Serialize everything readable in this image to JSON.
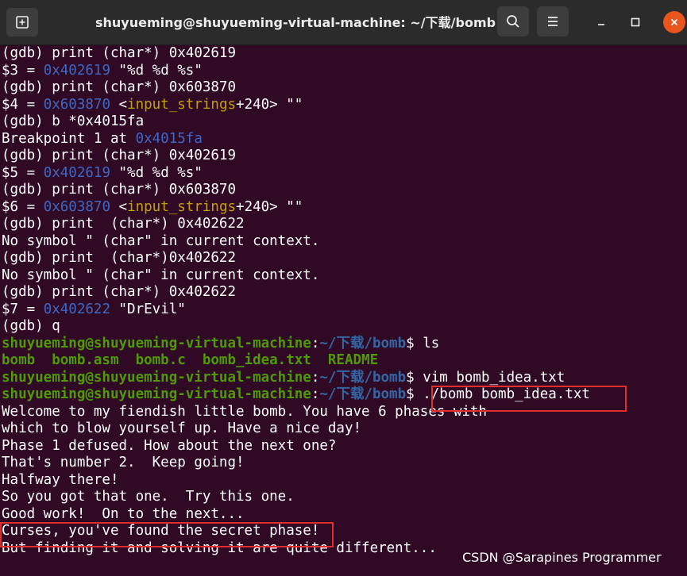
{
  "window": {
    "title": "shuyueming@shuyueming-virtual-machine: ~/下载/bomb"
  },
  "icons": {
    "new_tab": "new-tab-icon",
    "search": "search-icon",
    "menu": "hamburger-menu-icon",
    "minimize": "minimize-icon",
    "maximize": "maximize-icon",
    "close": "close-icon"
  },
  "colors": {
    "background": "#300a24",
    "address": "#3d67c6",
    "symbol": "#c4a000",
    "prompt_user": "#4e9a06",
    "prompt_path": "#3465a4",
    "highlight_box": "#e32d2d"
  },
  "lines": [
    {
      "segments": [
        {
          "t": "(gdb) print (char*) 0x402619"
        }
      ]
    },
    {
      "segments": [
        {
          "t": "$3 = "
        },
        {
          "t": "0x402619",
          "c": "blue"
        },
        {
          "t": " \"%d %d %s\""
        }
      ]
    },
    {
      "segments": [
        {
          "t": "(gdb) print (char*) 0x603870"
        }
      ]
    },
    {
      "segments": [
        {
          "t": "$4 = "
        },
        {
          "t": "0x603870",
          "c": "blue"
        },
        {
          "t": " <"
        },
        {
          "t": "input_strings",
          "c": "yellow"
        },
        {
          "t": "+240> \"\""
        }
      ]
    },
    {
      "segments": [
        {
          "t": "(gdb) b *0x4015fa"
        }
      ]
    },
    {
      "segments": [
        {
          "t": "Breakpoint 1 at "
        },
        {
          "t": "0x4015fa",
          "c": "blue"
        }
      ]
    },
    {
      "segments": [
        {
          "t": "(gdb) print (char*) 0x402619"
        }
      ]
    },
    {
      "segments": [
        {
          "t": "$5 = "
        },
        {
          "t": "0x402619",
          "c": "blue"
        },
        {
          "t": " \"%d %d %s\""
        }
      ]
    },
    {
      "segments": [
        {
          "t": "(gdb) print (char*) 0x603870"
        }
      ]
    },
    {
      "segments": [
        {
          "t": "$6 = "
        },
        {
          "t": "0x603870",
          "c": "blue"
        },
        {
          "t": " <"
        },
        {
          "t": "input_strings",
          "c": "yellow"
        },
        {
          "t": "+240> \"\""
        }
      ]
    },
    {
      "segments": [
        {
          "t": "(gdb) print  (char*) 0x402622"
        }
      ]
    },
    {
      "segments": [
        {
          "t": "No symbol \" (char\" in current context."
        }
      ]
    },
    {
      "segments": [
        {
          "t": "(gdb) print  (char*)0x402622"
        }
      ]
    },
    {
      "segments": [
        {
          "t": "No symbol \" (char\" in current context."
        }
      ]
    },
    {
      "segments": [
        {
          "t": "(gdb) print (char*) 0x402622"
        }
      ]
    },
    {
      "segments": [
        {
          "t": "$7 = "
        },
        {
          "t": "0x402622",
          "c": "blue"
        },
        {
          "t": " \"DrEvil\""
        }
      ]
    },
    {
      "segments": [
        {
          "t": "(gdb) q"
        }
      ]
    },
    {
      "segments": [
        {
          "t": "shuyueming@shuyueming-virtual-machine",
          "c": "green"
        },
        {
          "t": ":"
        },
        {
          "t": "~/下载/bomb",
          "c": "bluebold"
        },
        {
          "t": "$ ls"
        }
      ]
    },
    {
      "segments": [
        {
          "t": "bomb  bomb.asm  bomb.c  bomb_idea.txt  README",
          "c": "green"
        }
      ]
    },
    {
      "segments": [
        {
          "t": "shuyueming@shuyueming-virtual-machine",
          "c": "green"
        },
        {
          "t": ":"
        },
        {
          "t": "~/下载/bomb",
          "c": "bluebold"
        },
        {
          "t": "$ vim bomb_idea.txt"
        }
      ]
    },
    {
      "segments": [
        {
          "t": "shuyueming@shuyueming-virtual-machine",
          "c": "green"
        },
        {
          "t": ":"
        },
        {
          "t": "~/下载/bomb",
          "c": "bluebold"
        },
        {
          "t": "$ ./bomb bomb_idea.txt"
        }
      ]
    },
    {
      "segments": [
        {
          "t": "Welcome to my fiendish little bomb. You have 6 phases with"
        }
      ]
    },
    {
      "segments": [
        {
          "t": "which to blow yourself up. Have a nice day!"
        }
      ]
    },
    {
      "segments": [
        {
          "t": "Phase 1 defused. How about the next one?"
        }
      ]
    },
    {
      "segments": [
        {
          "t": "That's number 2.  Keep going!"
        }
      ]
    },
    {
      "segments": [
        {
          "t": "Halfway there!"
        }
      ]
    },
    {
      "segments": [
        {
          "t": "So you got that one.  Try this one."
        }
      ]
    },
    {
      "segments": [
        {
          "t": "Good work!  On to the next..."
        }
      ]
    },
    {
      "segments": [
        {
          "t": "Curses, you've found the secret phase!"
        }
      ]
    },
    {
      "segments": [
        {
          "t": "But finding it and solving it are quite different..."
        }
      ]
    }
  ],
  "watermark": "CSDN @Sarapines Programmer"
}
